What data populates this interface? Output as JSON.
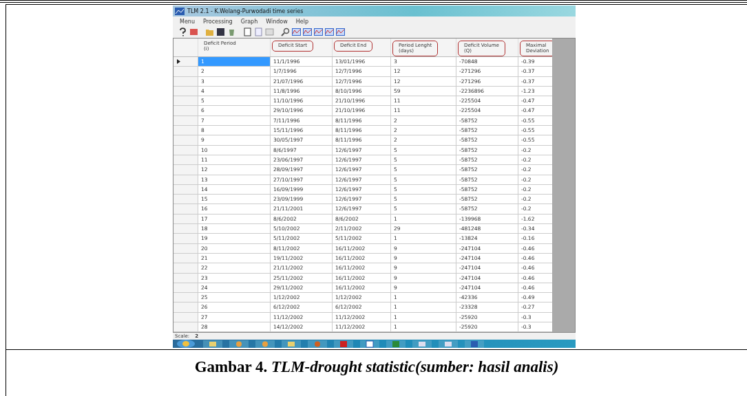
{
  "window": {
    "title": "TLM 2.1 - K.Welang-Purwodadi time series"
  },
  "menu": [
    "Menu",
    "Processing",
    "Graph",
    "Window",
    "Help"
  ],
  "table": {
    "columns": [
      {
        "label": "Deficit Period\n(i)",
        "circled": false
      },
      {
        "label": "Deficit Start",
        "circled": true
      },
      {
        "label": "Deficit End",
        "circled": true
      },
      {
        "label": "Period Lenght\n(days)",
        "circled": true
      },
      {
        "label": "Deficit Volume\n(Q)",
        "circled": true
      },
      {
        "label": "Maximal\nDeviation",
        "circled": true
      }
    ],
    "rows": [
      {
        "current": true,
        "selected": true,
        "cells": [
          "1",
          "11/1/1996",
          "13/01/1996",
          "3",
          "-70848",
          "-0.39"
        ]
      },
      {
        "current": false,
        "selected": false,
        "cells": [
          "2",
          "1/7/1996",
          "12/7/1996",
          "12",
          "-271296",
          "-0.37"
        ]
      },
      {
        "current": false,
        "selected": false,
        "cells": [
          "3",
          "21/07/1996",
          "12/7/1996",
          "12",
          "-271296",
          "-0.37"
        ]
      },
      {
        "current": false,
        "selected": false,
        "cells": [
          "4",
          "11/8/1996",
          "8/10/1996",
          "59",
          "-2236896",
          "-1.23"
        ]
      },
      {
        "current": false,
        "selected": false,
        "cells": [
          "5",
          "11/10/1996",
          "21/10/1996",
          "11",
          "-225504",
          "-0.47"
        ]
      },
      {
        "current": false,
        "selected": false,
        "cells": [
          "6",
          "29/10/1996",
          "21/10/1996",
          "11",
          "-225504",
          "-0.47"
        ]
      },
      {
        "current": false,
        "selected": false,
        "cells": [
          "7",
          "7/11/1996",
          "8/11/1996",
          "2",
          "-58752",
          "-0.55"
        ]
      },
      {
        "current": false,
        "selected": false,
        "cells": [
          "8",
          "15/11/1996",
          "8/11/1996",
          "2",
          "-58752",
          "-0.55"
        ]
      },
      {
        "current": false,
        "selected": false,
        "cells": [
          "9",
          "30/05/1997",
          "8/11/1996",
          "2",
          "-58752",
          "-0.55"
        ]
      },
      {
        "current": false,
        "selected": false,
        "cells": [
          "10",
          "8/6/1997",
          "12/6/1997",
          "5",
          "-58752",
          "-0.2"
        ]
      },
      {
        "current": false,
        "selected": false,
        "cells": [
          "11",
          "23/06/1997",
          "12/6/1997",
          "5",
          "-58752",
          "-0.2"
        ]
      },
      {
        "current": false,
        "selected": false,
        "cells": [
          "12",
          "28/09/1997",
          "12/6/1997",
          "5",
          "-58752",
          "-0.2"
        ]
      },
      {
        "current": false,
        "selected": false,
        "cells": [
          "13",
          "27/10/1997",
          "12/6/1997",
          "5",
          "-58752",
          "-0.2"
        ]
      },
      {
        "current": false,
        "selected": false,
        "cells": [
          "14",
          "16/09/1999",
          "12/6/1997",
          "5",
          "-58752",
          "-0.2"
        ]
      },
      {
        "current": false,
        "selected": false,
        "cells": [
          "15",
          "23/09/1999",
          "12/6/1997",
          "5",
          "-58752",
          "-0.2"
        ]
      },
      {
        "current": false,
        "selected": false,
        "cells": [
          "16",
          "21/11/2001",
          "12/6/1997",
          "5",
          "-58752",
          "-0.2"
        ]
      },
      {
        "current": false,
        "selected": false,
        "cells": [
          "17",
          "8/6/2002",
          "8/6/2002",
          "1",
          "-139968",
          "-1.62"
        ]
      },
      {
        "current": false,
        "selected": false,
        "cells": [
          "18",
          "5/10/2002",
          "2/11/2002",
          "29",
          "-481248",
          "-0.34"
        ]
      },
      {
        "current": false,
        "selected": false,
        "cells": [
          "19",
          "5/11/2002",
          "5/11/2002",
          "1",
          "-13824",
          "-0.16"
        ]
      },
      {
        "current": false,
        "selected": false,
        "cells": [
          "20",
          "8/11/2002",
          "16/11/2002",
          "9",
          "-247104",
          "-0.46"
        ]
      },
      {
        "current": false,
        "selected": false,
        "cells": [
          "21",
          "19/11/2002",
          "16/11/2002",
          "9",
          "-247104",
          "-0.46"
        ]
      },
      {
        "current": false,
        "selected": false,
        "cells": [
          "22",
          "21/11/2002",
          "16/11/2002",
          "9",
          "-247104",
          "-0.46"
        ]
      },
      {
        "current": false,
        "selected": false,
        "cells": [
          "23",
          "25/11/2002",
          "16/11/2002",
          "9",
          "-247104",
          "-0.46"
        ]
      },
      {
        "current": false,
        "selected": false,
        "cells": [
          "24",
          "29/11/2002",
          "16/11/2002",
          "9",
          "-247104",
          "-0.46"
        ]
      },
      {
        "current": false,
        "selected": false,
        "cells": [
          "25",
          "1/12/2002",
          "1/12/2002",
          "1",
          "-42336",
          "-0.49"
        ]
      },
      {
        "current": false,
        "selected": false,
        "cells": [
          "26",
          "6/12/2002",
          "6/12/2002",
          "1",
          "-23328",
          "-0.27"
        ]
      },
      {
        "current": false,
        "selected": false,
        "cells": [
          "27",
          "11/12/2002",
          "11/12/2002",
          "1",
          "-25920",
          "-0.3"
        ]
      },
      {
        "current": false,
        "selected": false,
        "cells": [
          "28",
          "14/12/2002",
          "11/12/2002",
          "1",
          "-25920",
          "-0.3"
        ]
      }
    ]
  },
  "status": {
    "label": "Scale:",
    "value": "2"
  },
  "caption": "Gambar 4. *TLM-drought statistic(sumber: hasil analis)*"
}
